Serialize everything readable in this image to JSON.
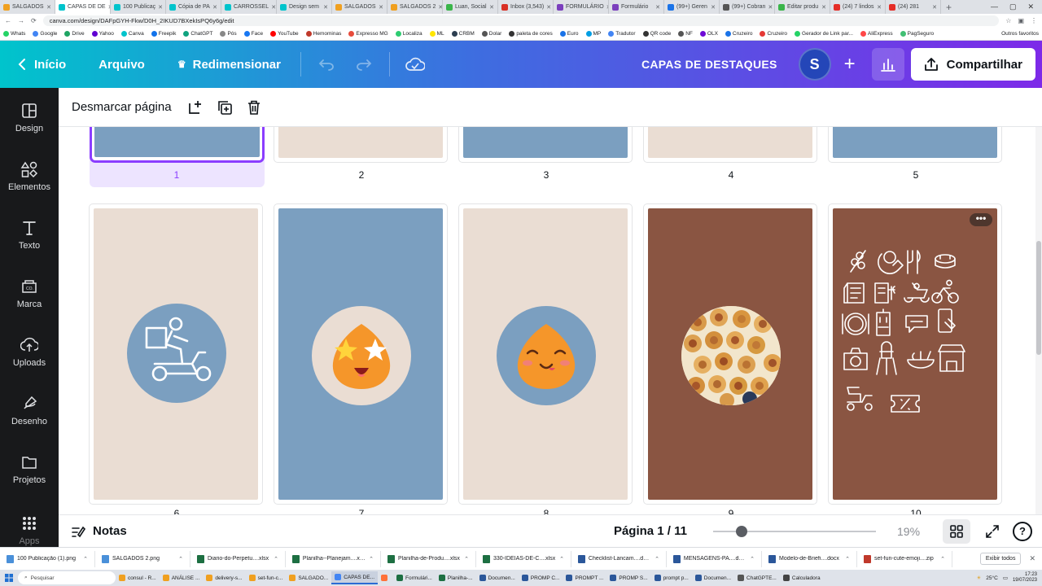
{
  "browser": {
    "tabs": [
      {
        "label": "SALGADOS",
        "color": "#f0a020"
      },
      {
        "label": "CAPAS DE DE",
        "color": "#00c4cc",
        "active": true
      },
      {
        "label": "100 Publicaç",
        "color": "#00c4cc"
      },
      {
        "label": "Cópia de PA",
        "color": "#00c4cc"
      },
      {
        "label": "CARROSSEL",
        "color": "#00c4cc"
      },
      {
        "label": "Design sem",
        "color": "#00c4cc"
      },
      {
        "label": "SALGADOS",
        "color": "#f0a020"
      },
      {
        "label": "SALGADOS 2",
        "color": "#f0a020"
      },
      {
        "label": "Luan, Social",
        "color": "#3ab54a"
      },
      {
        "label": "Inbox (3,543)",
        "color": "#d93025"
      },
      {
        "label": "FORMULÁRIO",
        "color": "#7b3fbd"
      },
      {
        "label": "Formulário",
        "color": "#7b3fbd"
      },
      {
        "label": "(99+) Geren",
        "color": "#1a73e8"
      },
      {
        "label": "(99+) Cobran",
        "color": "#555"
      },
      {
        "label": "Editar produ",
        "color": "#3ab54a"
      },
      {
        "label": "(24) 7 lindos",
        "color": "#e52d27"
      },
      {
        "label": "(24) 281",
        "color": "#e52d27"
      }
    ],
    "new_tab": "+",
    "url": "canva.com/design/DAFpGYH-Fkw/D0H_2IKUD7BXekIsPQ6y6g/edit",
    "bookmarks": [
      {
        "label": "Whats",
        "color": "#25d366"
      },
      {
        "label": "Google",
        "color": "#4285f4"
      },
      {
        "label": "Drive",
        "color": "#1fa463"
      },
      {
        "label": "Yahoo",
        "color": "#6001d2"
      },
      {
        "label": "Canva",
        "color": "#00c4cc"
      },
      {
        "label": "Freepik",
        "color": "#1273eb"
      },
      {
        "label": "ChatGPT",
        "color": "#10a37f"
      },
      {
        "label": "Pós",
        "color": "#888"
      },
      {
        "label": "Face",
        "color": "#1877f2"
      },
      {
        "label": "YouTube",
        "color": "#ff0000"
      },
      {
        "label": "Hemominas",
        "color": "#c0392b"
      },
      {
        "label": "Expresso MG",
        "color": "#e74c3c"
      },
      {
        "label": "Localiza",
        "color": "#2ecc71"
      },
      {
        "label": "ML",
        "color": "#ffe600"
      },
      {
        "label": "CRBM",
        "color": "#2c3e50"
      },
      {
        "label": "Dolar",
        "color": "#555"
      },
      {
        "label": "paleta de cores",
        "color": "#333"
      },
      {
        "label": "Euro",
        "color": "#1a73e8"
      },
      {
        "label": "MP",
        "color": "#009ee3"
      },
      {
        "label": "Tradutor",
        "color": "#4285f4"
      },
      {
        "label": "QR code",
        "color": "#333"
      },
      {
        "label": "NF",
        "color": "#555"
      },
      {
        "label": "OLX",
        "color": "#6e0ad6"
      },
      {
        "label": "Cruzeiro",
        "color": "#1a73e8"
      },
      {
        "label": "Cruzeiro",
        "color": "#e53935"
      },
      {
        "label": "Gerador de Link par...",
        "color": "#25d366"
      },
      {
        "label": "AliExpress",
        "color": "#ff4747"
      },
      {
        "label": "PagSeguro",
        "color": "#41bf73"
      }
    ],
    "bookmarks_other": "Outros favoritos"
  },
  "canva": {
    "back_label": "Início",
    "file_label": "Arquivo",
    "resize_label": "Redimensionar",
    "project_title": "CAPAS DE DESTAQUES",
    "avatar_initial": "S",
    "share_label": "Compartilhar",
    "colors": {
      "accent": "#8b3dff",
      "blue_panel": "#7b9fc0",
      "beige_panel": "#eaddd3",
      "brown_panel": "#8a5542"
    }
  },
  "sidebar": {
    "items": [
      {
        "label": "Design",
        "icon": "design-icon"
      },
      {
        "label": "Elementos",
        "icon": "elements-icon"
      },
      {
        "label": "Texto",
        "icon": "text-icon"
      },
      {
        "label": "Marca",
        "icon": "brand-icon"
      },
      {
        "label": "Uploads",
        "icon": "upload-icon"
      },
      {
        "label": "Desenho",
        "icon": "draw-icon"
      },
      {
        "label": "Projetos",
        "icon": "folder-icon"
      },
      {
        "label": "Apps",
        "icon": "apps-icon"
      }
    ]
  },
  "page_toolbar": {
    "unmark_label": "Desmarcar página"
  },
  "pages": {
    "row1_numbers": [
      "1",
      "2",
      "3",
      "4",
      "5"
    ],
    "row2_numbers": [
      "6",
      "7",
      "8",
      "9",
      "10"
    ],
    "more_label": "•••"
  },
  "bottom": {
    "notes_label": "Notas",
    "page_indicator": "Página 1 / 11",
    "zoom": "19%",
    "help": "?"
  },
  "downloads": {
    "items": [
      {
        "label": "100 Publicação (1).png",
        "color": "#4a90d9"
      },
      {
        "label": "SALGADOS 2.png",
        "color": "#4a90d9"
      },
      {
        "label": "Diario-do-Perpetu....xlsx",
        "color": "#1d6f42"
      },
      {
        "label": "Planilha--Planejam....xlsx",
        "color": "#1d6f42"
      },
      {
        "label": "Planilha-de-Produ....xlsx",
        "color": "#1d6f42"
      },
      {
        "label": "330-IDEIAS-DE-C....xlsx",
        "color": "#1d6f42"
      },
      {
        "label": "Checklist-Lancam....docx",
        "color": "#2b579a"
      },
      {
        "label": "MENSAGENS-PA....docx",
        "color": "#2b579a"
      },
      {
        "label": "Modelo-de-Briefi....docx",
        "color": "#2b579a"
      },
      {
        "label": "set-fun-cute-emoji....zip",
        "color": "#c0392b"
      }
    ],
    "show_all": "Exibir todos"
  },
  "taskbar": {
    "search_placeholder": "Pesquisar",
    "items": [
      {
        "label": "consul - R...",
        "color": "#f0a020"
      },
      {
        "label": "ANÁLISE ...",
        "color": "#f0a020"
      },
      {
        "label": "delivery-s...",
        "color": "#f0a020"
      },
      {
        "label": "set-fun-c...",
        "color": "#f0a020"
      },
      {
        "label": "SALGADO...",
        "color": "#f0a020"
      },
      {
        "label": "CAPAS DE...",
        "color": "#4285f4",
        "active": true
      },
      {
        "label": "",
        "color": "#ff7139"
      },
      {
        "label": "Formulári...",
        "color": "#1d6f42"
      },
      {
        "label": "Planilha-...",
        "color": "#1d6f42"
      },
      {
        "label": "Documen...",
        "color": "#2b579a"
      },
      {
        "label": "PROMP C...",
        "color": "#2b579a"
      },
      {
        "label": "PROMPT ...",
        "color": "#2b579a"
      },
      {
        "label": "PROMP S...",
        "color": "#2b579a"
      },
      {
        "label": "prompt p...",
        "color": "#2b579a"
      },
      {
        "label": "Documen...",
        "color": "#2b579a"
      },
      {
        "label": "ChatGPTE...",
        "color": "#555"
      },
      {
        "label": "Calculadora",
        "color": "#444"
      }
    ],
    "weather": "25°C",
    "time": "17:23",
    "date": "19/07/2023"
  }
}
